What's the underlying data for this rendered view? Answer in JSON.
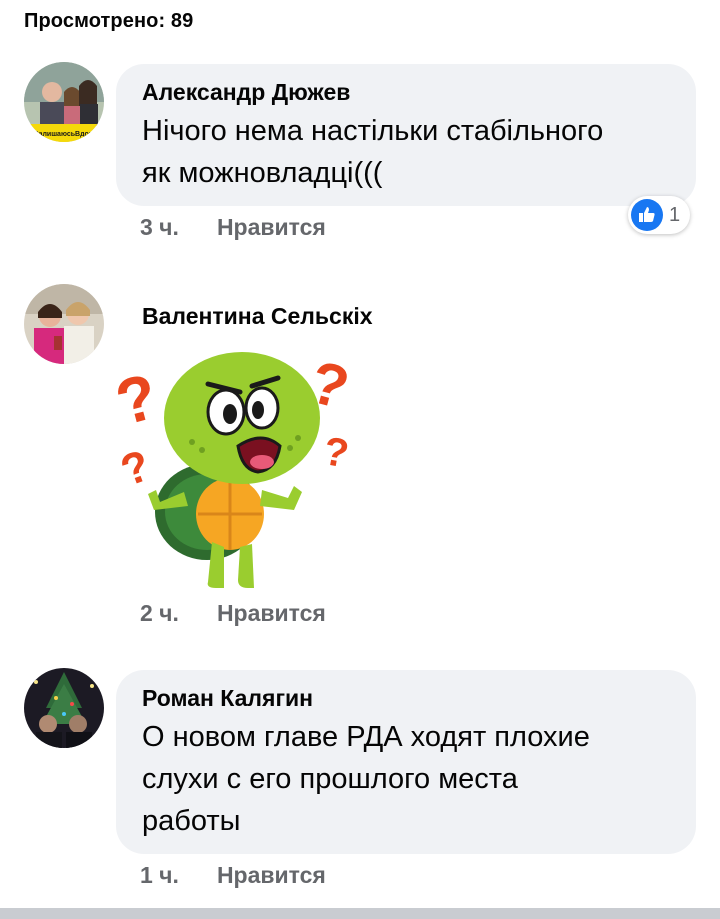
{
  "views_label": "Просмотрено: 89",
  "comments": [
    {
      "author": "Александр Дюжев",
      "text_lines": [
        "Нічого нема настільки стабільного",
        "як можновладці((("
      ],
      "time": "3 ч.",
      "like_label": "Нравится",
      "reactions": {
        "icon": "thumbs-up-icon",
        "count": "1"
      },
      "avatar_banner": "#ЗалишаюсьВдома"
    },
    {
      "author": "Валентина Сельскіх",
      "sticker": "confused-turtle-sticker",
      "time": "2 ч.",
      "like_label": "Нравится"
    },
    {
      "author": "Роман Калягин",
      "text_lines": [
        "О новом главе РДА ходят плохие",
        "слухи с его прошлого места",
        "работы"
      ],
      "time": "1 ч.",
      "like_label": "Нравится"
    }
  ],
  "colors": {
    "bubble_bg": "#f0f2f5",
    "meta_text": "#65676b",
    "like_blue": "#1877f2"
  }
}
